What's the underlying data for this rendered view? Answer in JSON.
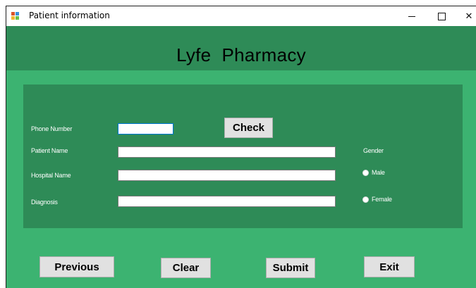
{
  "window": {
    "title": "Patient information",
    "controls": {
      "minimize": "",
      "maximize": "",
      "close": "✕"
    }
  },
  "app": {
    "title": "Lyfe  Pharmacy"
  },
  "form": {
    "phone_label": "Phone Number",
    "phone_value": "",
    "patient_label": "Patient Name",
    "patient_value": "",
    "hospital_label": "Hospital Name",
    "hospital_value": "",
    "diagnosis_label": "Diagnosis",
    "diagnosis_value": "",
    "check_label": "Check",
    "gender_label": "Gender",
    "gender_options": [
      "Male",
      "Female"
    ],
    "gender_selected": null
  },
  "buttons": {
    "previous": "Previous",
    "clear": "Clear",
    "submit": "Submit",
    "exit": "Exit"
  },
  "colors": {
    "form_background": "#3cb371",
    "panel_background": "#2e8b57",
    "button_face": "#e1e1e1"
  }
}
